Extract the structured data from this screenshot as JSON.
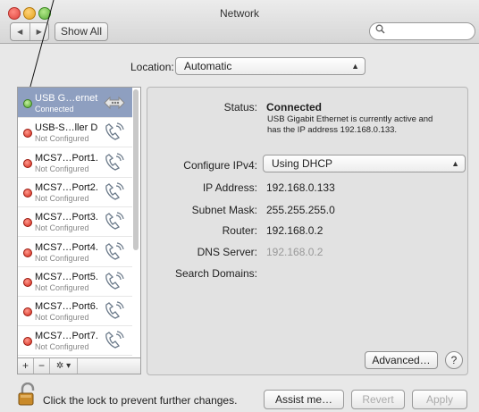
{
  "window": {
    "title": "Network"
  },
  "toolbar": {
    "back_glyph": "◀",
    "forward_glyph": "▶",
    "show_all_label": "Show All",
    "search_value": "",
    "search_placeholder": ""
  },
  "location": {
    "label": "Location:",
    "value": "Automatic"
  },
  "services": [
    {
      "name": "USB G…ernet",
      "status": "Connected",
      "state": "green",
      "icon": "ethernet-icon",
      "selected": true
    },
    {
      "name": "USB-S…ller D",
      "status": "Not Configured",
      "state": "red",
      "icon": "phone-icon",
      "selected": false
    },
    {
      "name": "MCS7…Port1.",
      "status": "Not Configured",
      "state": "red",
      "icon": "phone-icon",
      "selected": false
    },
    {
      "name": "MCS7…Port2.",
      "status": "Not Configured",
      "state": "red",
      "icon": "phone-icon",
      "selected": false
    },
    {
      "name": "MCS7…Port3.",
      "status": "Not Configured",
      "state": "red",
      "icon": "phone-icon",
      "selected": false
    },
    {
      "name": "MCS7…Port4.",
      "status": "Not Configured",
      "state": "red",
      "icon": "phone-icon",
      "selected": false
    },
    {
      "name": "MCS7…Port5.",
      "status": "Not Configured",
      "state": "red",
      "icon": "phone-icon",
      "selected": false
    },
    {
      "name": "MCS7…Port6.",
      "status": "Not Configured",
      "state": "red",
      "icon": "phone-icon",
      "selected": false
    },
    {
      "name": "MCS7…Port7.",
      "status": "Not Configured",
      "state": "red",
      "icon": "phone-icon",
      "selected": false
    }
  ],
  "sidebar_actions": {
    "add": "+",
    "remove": "−",
    "gear": "✲ ▾"
  },
  "detail": {
    "status_label": "Status:",
    "status_value": "Connected",
    "status_note": "USB Gigabit Ethernet is currently active and has the IP address 192.168.0.133.",
    "configure_label": "Configure IPv4:",
    "configure_value": "Using DHCP",
    "ip_label": "IP Address:",
    "ip_value": "192.168.0.133",
    "subnet_label": "Subnet Mask:",
    "subnet_value": "255.255.255.0",
    "router_label": "Router:",
    "router_value": "192.168.0.2",
    "dns_label": "DNS Server:",
    "dns_value": "192.168.0.2",
    "domains_label": "Search Domains:",
    "domains_value": "",
    "advanced_label": "Advanced…",
    "help_label": "?"
  },
  "footer": {
    "lock_text": "Click the lock to prevent further changes.",
    "assist_label": "Assist me…",
    "revert_label": "Revert",
    "apply_label": "Apply"
  },
  "colors": {
    "selected_row": "#8e9fc0",
    "status_green": "#4fa52a",
    "status_red": "#d42a1a"
  }
}
